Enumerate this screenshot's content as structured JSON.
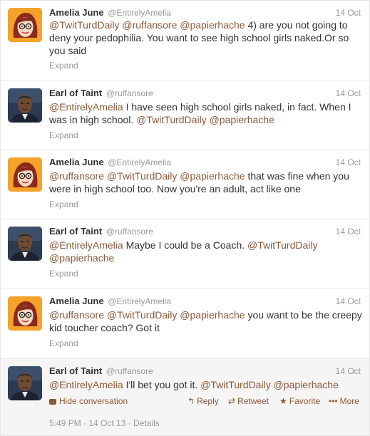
{
  "tweets": [
    {
      "author": "Amelia June",
      "handle": "@EntirelyAmelia",
      "date": "14 Oct",
      "text_parts": [
        "@TwitTurdDaily",
        " ",
        "@ruffansore",
        " ",
        "@papierhache",
        " 4) are you not going to deny your pedophilia. You want to see high school girls naked.Or so you said"
      ],
      "expand": "Expand",
      "avatar": "cartoon-woman-avatar"
    },
    {
      "author": "Earl of Taint",
      "handle": "@ruffansore",
      "date": "14 Oct",
      "text_parts": [
        "@EntirelyAmelia",
        " I have seen high school girls naked, in fact. When I was in high school. ",
        "@TwitTurdDaily",
        " ",
        "@papierhache"
      ],
      "expand": "Expand",
      "avatar": "man-photo-avatar"
    },
    {
      "author": "Amelia June",
      "handle": "@EntirelyAmelia",
      "date": "14 Oct",
      "text_parts": [
        "@ruffansore",
        " ",
        "@TwitTurdDaily",
        " ",
        "@papierhache",
        " that was fine when you were in high school too. Now you're an adult, act like one"
      ],
      "expand": "Expand",
      "avatar": "cartoon-woman-avatar"
    },
    {
      "author": "Earl of Taint",
      "handle": "@ruffansore",
      "date": "14 Oct",
      "text_parts": [
        "@EntirelyAmelia",
        " Maybe I could be a Coach. ",
        "@TwitTurdDaily",
        " ",
        "@papierhache"
      ],
      "expand": "Expand",
      "avatar": "man-photo-avatar"
    },
    {
      "author": "Amelia June",
      "handle": "@EntirelyAmelia",
      "date": "14 Oct",
      "text_parts": [
        "@ruffansore",
        " ",
        "@TwitTurdDaily",
        " ",
        "@papierhache",
        " you want to be the creepy kid toucher coach? Got it"
      ],
      "expand": "Expand",
      "avatar": "cartoon-woman-avatar"
    },
    {
      "author": "Earl of Taint",
      "handle": "@ruffansore",
      "date": "14 Oct",
      "text_parts": [
        "@EntirelyAmelia",
        " I'll bet you got it. ",
        "@TwitTurdDaily",
        " ",
        "@papierhache"
      ],
      "avatar": "man-photo-avatar"
    }
  ],
  "expanded": {
    "hide_conversation": "Hide conversation",
    "reply": "Reply",
    "retweet": "Retweet",
    "favorite": "Favorite",
    "more": "More",
    "meta": "5:49 PM - 14 Oct 13 · Details"
  },
  "colors": {
    "mention": "#8b5a3a",
    "muted": "#999999",
    "woman_avatar_bg": "#f4a22a"
  }
}
